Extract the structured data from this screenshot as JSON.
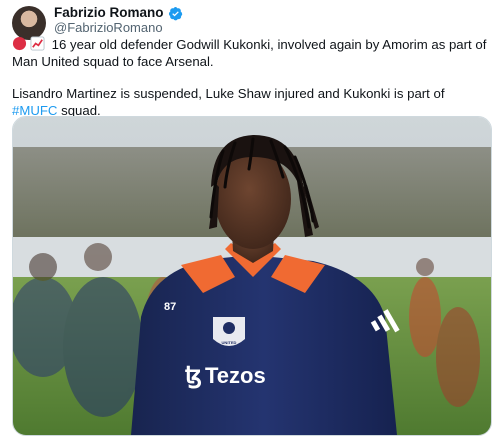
{
  "author": {
    "name": "Fabrizio Romano",
    "handle": "@FabrizioRomano",
    "verified_color": "#1d9bf0"
  },
  "tweet": {
    "line1_prefix_icons": [
      "red-circle-icon",
      "chart-increasing-icon"
    ],
    "line1": "16 year old defender Godwill Kukonki, involved again by Amorim as part of Man United squad to face Arsenal.",
    "line2_start": "Lisandro Martinez is suspended, Luke Shaw injured and Kukonki is part of ",
    "hashtag": "#MUFC",
    "line2_end": " squad."
  },
  "photo": {
    "shirt_number": "87",
    "sponsor": "Tezos",
    "crest_text": "UNITED",
    "colors": {
      "shirt": "#1f2d63",
      "shoulder": "#f06a32",
      "grass": "#5f8a3c"
    }
  }
}
